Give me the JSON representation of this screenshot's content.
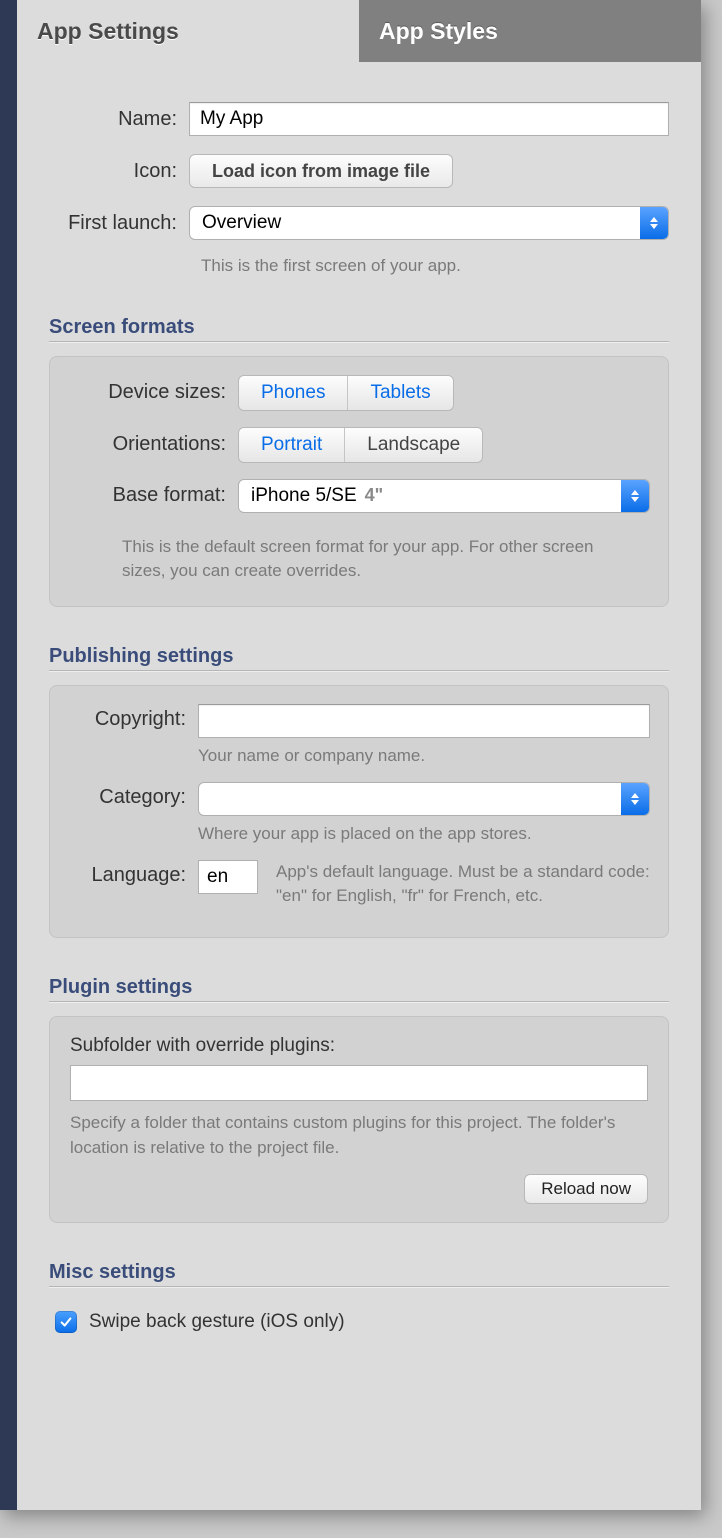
{
  "tabs": {
    "settings": "App Settings",
    "styles": "App Styles"
  },
  "general": {
    "name_label": "Name:",
    "name_value": "My App",
    "icon_label": "Icon:",
    "icon_button": "Load icon from image file",
    "first_launch_label": "First launch:",
    "first_launch_value": "Overview",
    "first_launch_hint": "This is the first screen of your app."
  },
  "screen_formats": {
    "title": "Screen formats",
    "device_sizes_label": "Device sizes:",
    "device_sizes": {
      "phones": "Phones",
      "tablets": "Tablets"
    },
    "orientations_label": "Orientations:",
    "orientations": {
      "portrait": "Portrait",
      "landscape": "Landscape"
    },
    "base_format_label": "Base format:",
    "base_format_value": "iPhone 5/SE",
    "base_format_size": "4\"",
    "hint": "This is the default screen format for your app. For other screen sizes, you can create overrides."
  },
  "publishing": {
    "title": "Publishing settings",
    "copyright_label": "Copyright:",
    "copyright_value": "",
    "copyright_hint": "Your name or company name.",
    "category_label": "Category:",
    "category_value": "",
    "category_hint": "Where your app is placed on the app stores.",
    "language_label": "Language:",
    "language_value": "en",
    "language_hint": "App's default language. Must be a standard code: \"en\" for English, \"fr\" for French, etc."
  },
  "plugins": {
    "title": "Plugin settings",
    "subfolder_label": "Subfolder with override plugins:",
    "subfolder_value": "",
    "hint": "Specify a folder that contains custom plugins for this project. The folder's location is relative to the project file.",
    "reload_button": "Reload now"
  },
  "misc": {
    "title": "Misc settings",
    "swipe_back_label": "Swipe back gesture (iOS only)",
    "swipe_back_checked": true
  }
}
